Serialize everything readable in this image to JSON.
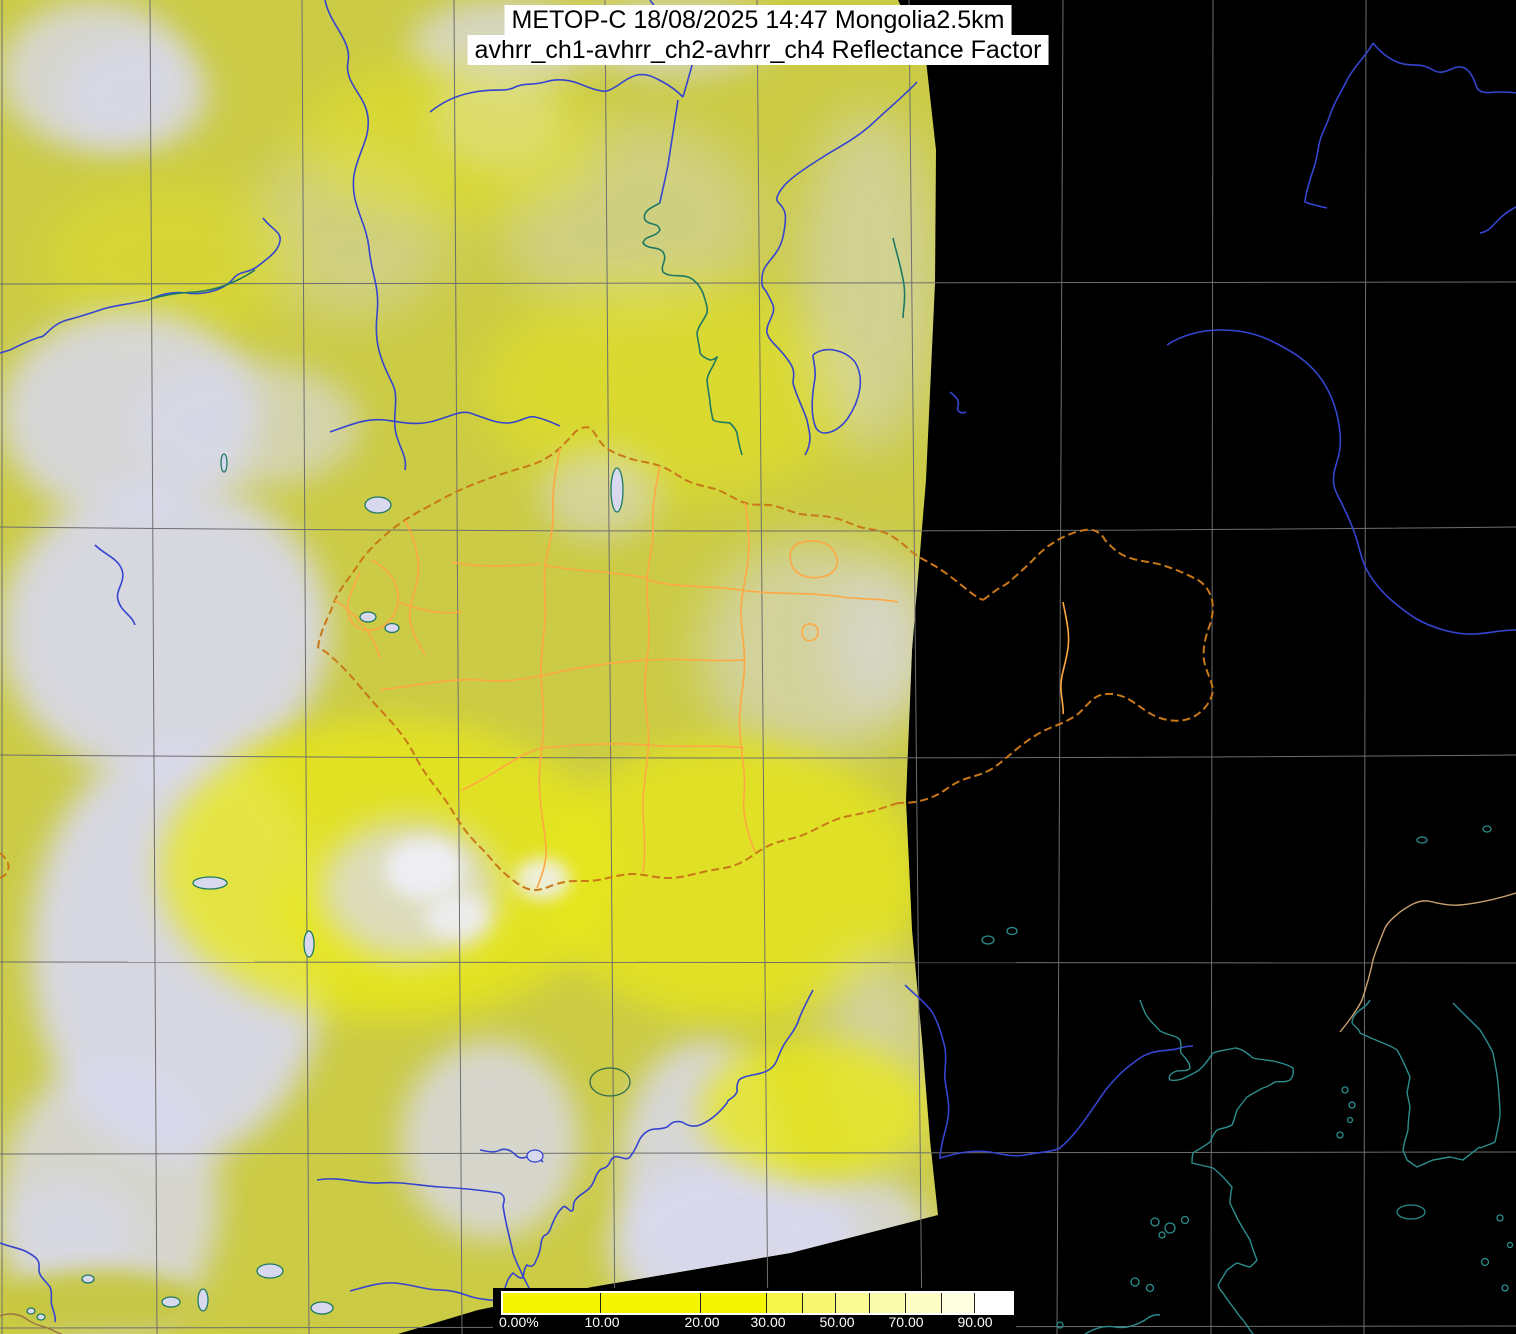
{
  "product": {
    "title_line1": "METOP-C 18/08/2025 14:47 Mongolia2.5km",
    "title_line2": "avhrr_ch1-avhrr_ch2-avhrr_ch4 Reflectance Factor",
    "satellite": "METOP-C",
    "date": "18/08/2025",
    "time": "14:47",
    "region": "Mongolia",
    "resolution": "2.5km",
    "channels": "avhrr_ch1-avhrr_ch2-avhrr_ch4",
    "quantity": "Reflectance Factor"
  },
  "colorbar": {
    "labels": [
      "0.00%",
      "10.00",
      "20.00",
      "30.00",
      "50.00",
      "70.00",
      "90.00"
    ],
    "tick_values_percent": [
      0,
      10,
      20,
      30,
      50,
      70,
      90
    ],
    "unit": "%",
    "segment_colors": [
      "#f5f500",
      "#f5f500",
      "#f5f500",
      "#f6f64a",
      "#f8f870",
      "#fafa92",
      "#fbfbac",
      "#fdfdc6",
      "#fefee0",
      "#ffffff"
    ],
    "background": "#000000",
    "text_color": "#ffffff"
  },
  "map_colors": {
    "land_base": "#cbcb45",
    "cloud_lavender": "#d9d9f0",
    "cloud_white": "#f0f0fa",
    "desert_bright_yellow": "#e7e71c",
    "no_data_black": "#000000",
    "graticule_gray": "#6e6e6e",
    "river_blue": "#3545cf",
    "river_teal": "#1e7a63",
    "coastline_teal": "#2d8d8d",
    "border_national_orange": "#c87818",
    "border_province_orange": "#ffa843",
    "border_tan": "#c8a070"
  }
}
